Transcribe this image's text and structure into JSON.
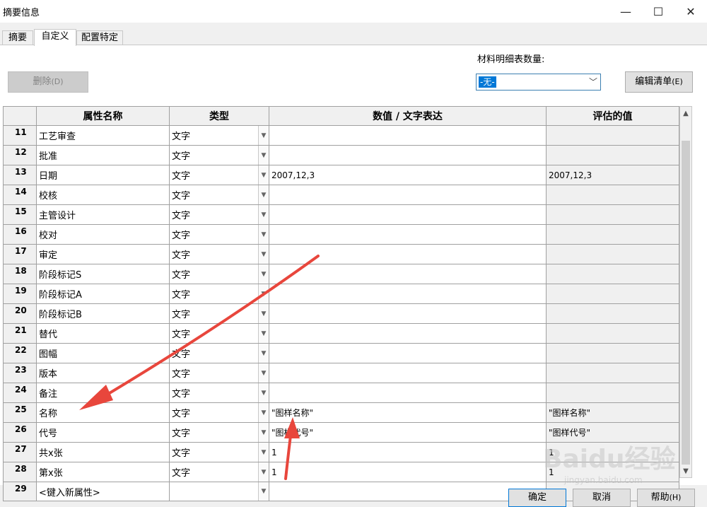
{
  "window": {
    "title": "摘要信息",
    "min_icon": "—",
    "max_icon": "☐",
    "close_icon": "✕"
  },
  "tabs": [
    {
      "label": "摘要"
    },
    {
      "label": "自定义"
    },
    {
      "label": "配置特定"
    }
  ],
  "toolbar": {
    "delete_label": "删除",
    "delete_accel": "(D)"
  },
  "bom": {
    "label": "材料明细表数量:",
    "selected": "-无-",
    "edit_label": "编辑清单",
    "edit_accel": "(E)"
  },
  "columns": {
    "num": "",
    "name": "属性名称",
    "type": "类型",
    "value": "数值 / 文字表达",
    "eval": "评估的值"
  },
  "rows": [
    {
      "num": "11",
      "name": "工艺审查",
      "type": "文字",
      "value": "",
      "eval": ""
    },
    {
      "num": "12",
      "name": "批准",
      "type": "文字",
      "value": "",
      "eval": ""
    },
    {
      "num": "13",
      "name": "日期",
      "type": "文字",
      "value": "2007,12,3",
      "eval": "2007,12,3"
    },
    {
      "num": "14",
      "name": "校核",
      "type": "文字",
      "value": "",
      "eval": ""
    },
    {
      "num": "15",
      "name": "主管设计",
      "type": "文字",
      "value": "",
      "eval": ""
    },
    {
      "num": "16",
      "name": "校对",
      "type": "文字",
      "value": "",
      "eval": ""
    },
    {
      "num": "17",
      "name": "审定",
      "type": "文字",
      "value": "",
      "eval": ""
    },
    {
      "num": "18",
      "name": "阶段标记S",
      "type": "文字",
      "value": "",
      "eval": ""
    },
    {
      "num": "19",
      "name": "阶段标记A",
      "type": "文字",
      "value": "",
      "eval": ""
    },
    {
      "num": "20",
      "name": "阶段标记B",
      "type": "文字",
      "value": "",
      "eval": ""
    },
    {
      "num": "21",
      "name": "替代",
      "type": "文字",
      "value": "",
      "eval": ""
    },
    {
      "num": "22",
      "name": "图幅",
      "type": "文字",
      "value": "",
      "eval": ""
    },
    {
      "num": "23",
      "name": "版本",
      "type": "文字",
      "value": "",
      "eval": ""
    },
    {
      "num": "24",
      "name": "备注",
      "type": "文字",
      "value": "",
      "eval": ""
    },
    {
      "num": "25",
      "name": "名称",
      "type": "文字",
      "value": "\"图样名称\"",
      "eval": "\"图样名称\""
    },
    {
      "num": "26",
      "name": "代号",
      "type": "文字",
      "value": "\"图样代号\"",
      "eval": "\"图样代号\""
    },
    {
      "num": "27",
      "name": "共x张",
      "type": "文字",
      "value": "1",
      "eval": "1"
    },
    {
      "num": "28",
      "name": "第x张",
      "type": "文字",
      "value": "1",
      "eval": "1"
    },
    {
      "num": "29",
      "name": "<键入新属性>",
      "type": "",
      "value": "",
      "eval": ""
    }
  ],
  "footer": {
    "ok_label": "确定",
    "cancel_label": "取消",
    "help_label": "帮助",
    "help_accel": "(H)"
  },
  "watermark": {
    "text": "Baidu经验",
    "sub": "jingyan.baidu.com"
  },
  "colors": {
    "accent": "#0078d7",
    "arrow": "#e8463c",
    "header_bg": "#f0f0f0"
  }
}
